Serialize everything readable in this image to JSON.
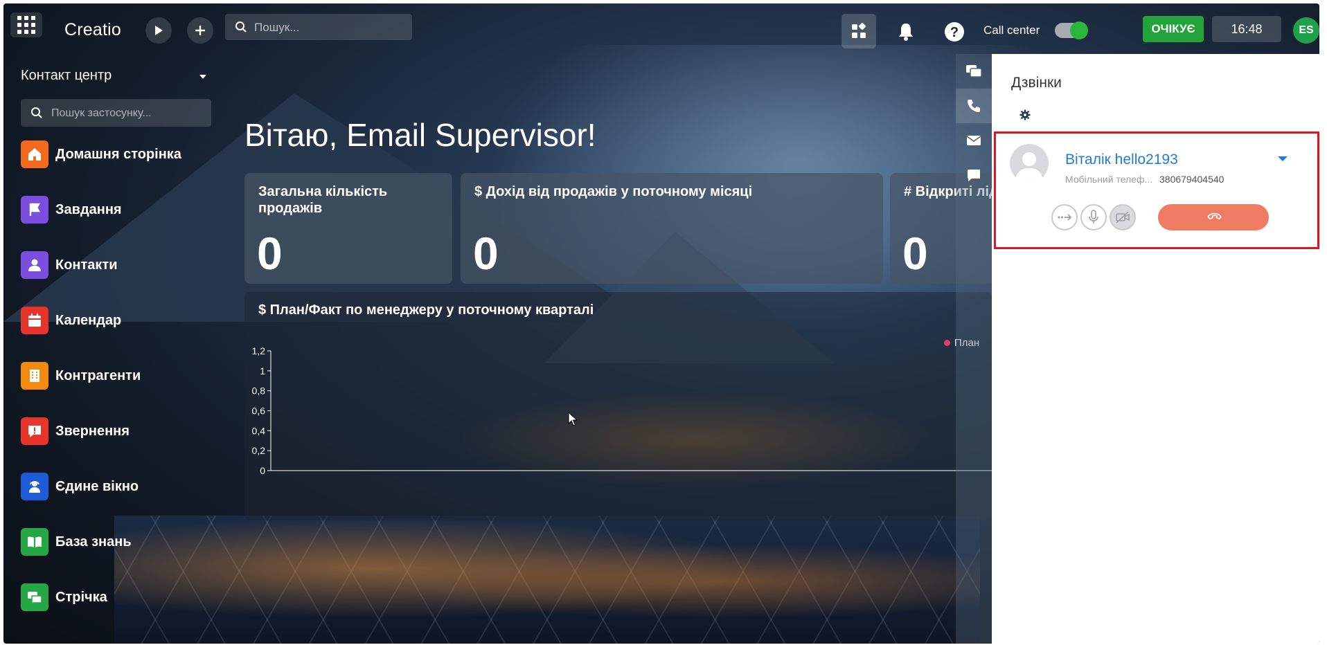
{
  "topbar": {
    "logo": "Creatio",
    "search_placeholder": "Пошук...",
    "callcenter_label": "Call center",
    "status": "ОЧІКУЄ",
    "time": "16:48",
    "user_initials": "ES"
  },
  "sidebar": {
    "title": "Контакт центр",
    "search_placeholder": "Пошук застосунку...",
    "items": [
      {
        "label": "Домашня сторінка",
        "color": "#f26a1b"
      },
      {
        "label": "Завдання",
        "color": "#7a4fe0"
      },
      {
        "label": "Контакти",
        "color": "#7a4fe0"
      },
      {
        "label": "Календар",
        "color": "#e8352b"
      },
      {
        "label": "Контрагенти",
        "color": "#f28a0f"
      },
      {
        "label": "Звернення",
        "color": "#e8352b"
      },
      {
        "label": "Єдине вікно",
        "color": "#1d5bd8"
      },
      {
        "label": "База знань",
        "color": "#24a744"
      },
      {
        "label": "Стрічка",
        "color": "#24a744"
      }
    ]
  },
  "main": {
    "greeting": "Вітаю, Email Supervisor!",
    "cards": [
      {
        "title": "Загальна кількість продажів",
        "value": "0"
      },
      {
        "title": "$ Дохід від продажів у поточному місяці",
        "value": "0"
      },
      {
        "title": "# Відкриті лід",
        "value": "0"
      }
    ]
  },
  "chart_data": {
    "type": "bar",
    "title": "$ План/Факт по менеджеру у поточному кварталі",
    "series": [
      {
        "name": "План",
        "values": []
      }
    ],
    "categories": [],
    "yticks": [
      "0",
      "0,2",
      "0,4",
      "0,6",
      "0,8",
      "1",
      "1,2"
    ],
    "ylim": [
      0,
      1.2
    ],
    "legend_color": "#e53c75"
  },
  "panel": {
    "title": "Дзвінки",
    "contact_name": "Віталік hello2193",
    "phone_type": "Мобільний телеф...",
    "phone_number": "380679404540",
    "hangup_color": "#ef7b63",
    "highlight_color": "#e0141e"
  }
}
